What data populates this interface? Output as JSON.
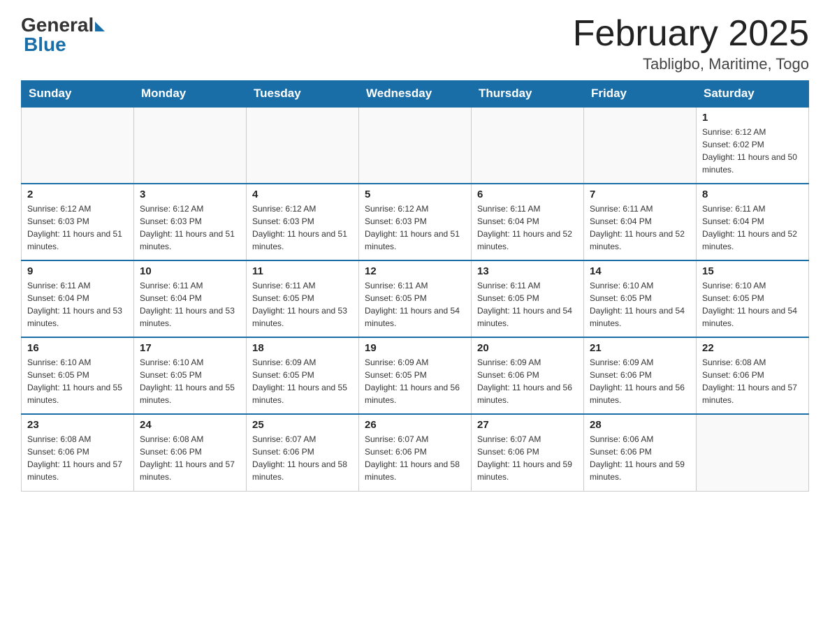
{
  "header": {
    "logo_general": "General",
    "logo_blue": "Blue",
    "month_title": "February 2025",
    "location": "Tabligbo, Maritime, Togo"
  },
  "days_of_week": [
    "Sunday",
    "Monday",
    "Tuesday",
    "Wednesday",
    "Thursday",
    "Friday",
    "Saturday"
  ],
  "weeks": [
    [
      {
        "day": "",
        "info": ""
      },
      {
        "day": "",
        "info": ""
      },
      {
        "day": "",
        "info": ""
      },
      {
        "day": "",
        "info": ""
      },
      {
        "day": "",
        "info": ""
      },
      {
        "day": "",
        "info": ""
      },
      {
        "day": "1",
        "info": "Sunrise: 6:12 AM\nSunset: 6:02 PM\nDaylight: 11 hours and 50 minutes."
      }
    ],
    [
      {
        "day": "2",
        "info": "Sunrise: 6:12 AM\nSunset: 6:03 PM\nDaylight: 11 hours and 51 minutes."
      },
      {
        "day": "3",
        "info": "Sunrise: 6:12 AM\nSunset: 6:03 PM\nDaylight: 11 hours and 51 minutes."
      },
      {
        "day": "4",
        "info": "Sunrise: 6:12 AM\nSunset: 6:03 PM\nDaylight: 11 hours and 51 minutes."
      },
      {
        "day": "5",
        "info": "Sunrise: 6:12 AM\nSunset: 6:03 PM\nDaylight: 11 hours and 51 minutes."
      },
      {
        "day": "6",
        "info": "Sunrise: 6:11 AM\nSunset: 6:04 PM\nDaylight: 11 hours and 52 minutes."
      },
      {
        "day": "7",
        "info": "Sunrise: 6:11 AM\nSunset: 6:04 PM\nDaylight: 11 hours and 52 minutes."
      },
      {
        "day": "8",
        "info": "Sunrise: 6:11 AM\nSunset: 6:04 PM\nDaylight: 11 hours and 52 minutes."
      }
    ],
    [
      {
        "day": "9",
        "info": "Sunrise: 6:11 AM\nSunset: 6:04 PM\nDaylight: 11 hours and 53 minutes."
      },
      {
        "day": "10",
        "info": "Sunrise: 6:11 AM\nSunset: 6:04 PM\nDaylight: 11 hours and 53 minutes."
      },
      {
        "day": "11",
        "info": "Sunrise: 6:11 AM\nSunset: 6:05 PM\nDaylight: 11 hours and 53 minutes."
      },
      {
        "day": "12",
        "info": "Sunrise: 6:11 AM\nSunset: 6:05 PM\nDaylight: 11 hours and 54 minutes."
      },
      {
        "day": "13",
        "info": "Sunrise: 6:11 AM\nSunset: 6:05 PM\nDaylight: 11 hours and 54 minutes."
      },
      {
        "day": "14",
        "info": "Sunrise: 6:10 AM\nSunset: 6:05 PM\nDaylight: 11 hours and 54 minutes."
      },
      {
        "day": "15",
        "info": "Sunrise: 6:10 AM\nSunset: 6:05 PM\nDaylight: 11 hours and 54 minutes."
      }
    ],
    [
      {
        "day": "16",
        "info": "Sunrise: 6:10 AM\nSunset: 6:05 PM\nDaylight: 11 hours and 55 minutes."
      },
      {
        "day": "17",
        "info": "Sunrise: 6:10 AM\nSunset: 6:05 PM\nDaylight: 11 hours and 55 minutes."
      },
      {
        "day": "18",
        "info": "Sunrise: 6:09 AM\nSunset: 6:05 PM\nDaylight: 11 hours and 55 minutes."
      },
      {
        "day": "19",
        "info": "Sunrise: 6:09 AM\nSunset: 6:05 PM\nDaylight: 11 hours and 56 minutes."
      },
      {
        "day": "20",
        "info": "Sunrise: 6:09 AM\nSunset: 6:06 PM\nDaylight: 11 hours and 56 minutes."
      },
      {
        "day": "21",
        "info": "Sunrise: 6:09 AM\nSunset: 6:06 PM\nDaylight: 11 hours and 56 minutes."
      },
      {
        "day": "22",
        "info": "Sunrise: 6:08 AM\nSunset: 6:06 PM\nDaylight: 11 hours and 57 minutes."
      }
    ],
    [
      {
        "day": "23",
        "info": "Sunrise: 6:08 AM\nSunset: 6:06 PM\nDaylight: 11 hours and 57 minutes."
      },
      {
        "day": "24",
        "info": "Sunrise: 6:08 AM\nSunset: 6:06 PM\nDaylight: 11 hours and 57 minutes."
      },
      {
        "day": "25",
        "info": "Sunrise: 6:07 AM\nSunset: 6:06 PM\nDaylight: 11 hours and 58 minutes."
      },
      {
        "day": "26",
        "info": "Sunrise: 6:07 AM\nSunset: 6:06 PM\nDaylight: 11 hours and 58 minutes."
      },
      {
        "day": "27",
        "info": "Sunrise: 6:07 AM\nSunset: 6:06 PM\nDaylight: 11 hours and 59 minutes."
      },
      {
        "day": "28",
        "info": "Sunrise: 6:06 AM\nSunset: 6:06 PM\nDaylight: 11 hours and 59 minutes."
      },
      {
        "day": "",
        "info": ""
      }
    ]
  ]
}
